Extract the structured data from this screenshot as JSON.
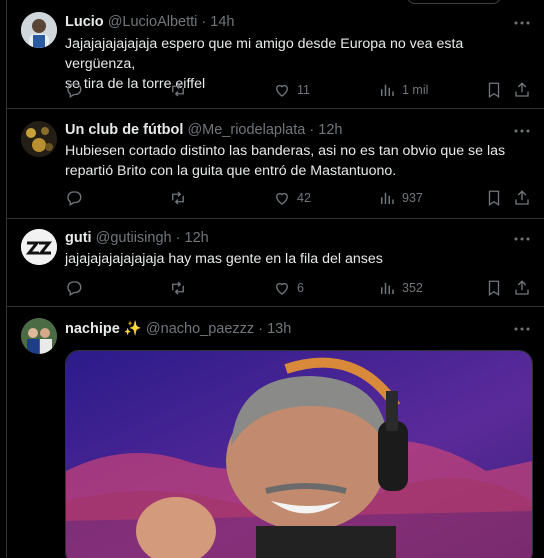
{
  "tweets": [
    {
      "name": "Lucio",
      "handle": "@LucioAlbetti",
      "dot": "·",
      "time": "14h",
      "text_line1": "Jajajajajajajaja espero que mi amigo desde Europa no vea esta vergüenza,",
      "text_line2": "se tira de la torre eiffel",
      "likes": "11",
      "views": "1 mil",
      "retweets": ""
    },
    {
      "name": "Un club de fútbol",
      "handle": "@Me_riodelaplata",
      "dot": "·",
      "time": "12h",
      "text_line1": "Hubiesen cortado distinto las banderas, asi no es tan obvio que se las",
      "text_line2": "repartió Brito con la guita que entró de Mastantuono.",
      "likes": "42",
      "views": "937",
      "retweets": ""
    },
    {
      "name": "guti",
      "handle": "@gutiisingh",
      "dot": "·",
      "time": "12h",
      "text_line1": "jajajajajajajajaja hay mas gente en la fila del anses",
      "likes": "6",
      "views": "352",
      "retweets": ""
    },
    {
      "name": "nachipe",
      "emoji": "✨",
      "handle": "@nacho_paezzz",
      "dot": "·",
      "time": "13h"
    }
  ],
  "icons": [
    "reply-icon",
    "retweet-icon",
    "like-icon",
    "views-icon",
    "bookmark-icon",
    "share-icon",
    "more-icon"
  ],
  "colors": {
    "background": "#000000",
    "text": "#e7e9ea",
    "muted": "#71767b",
    "border": "#2f3336",
    "sparkle": "#f7c948"
  }
}
